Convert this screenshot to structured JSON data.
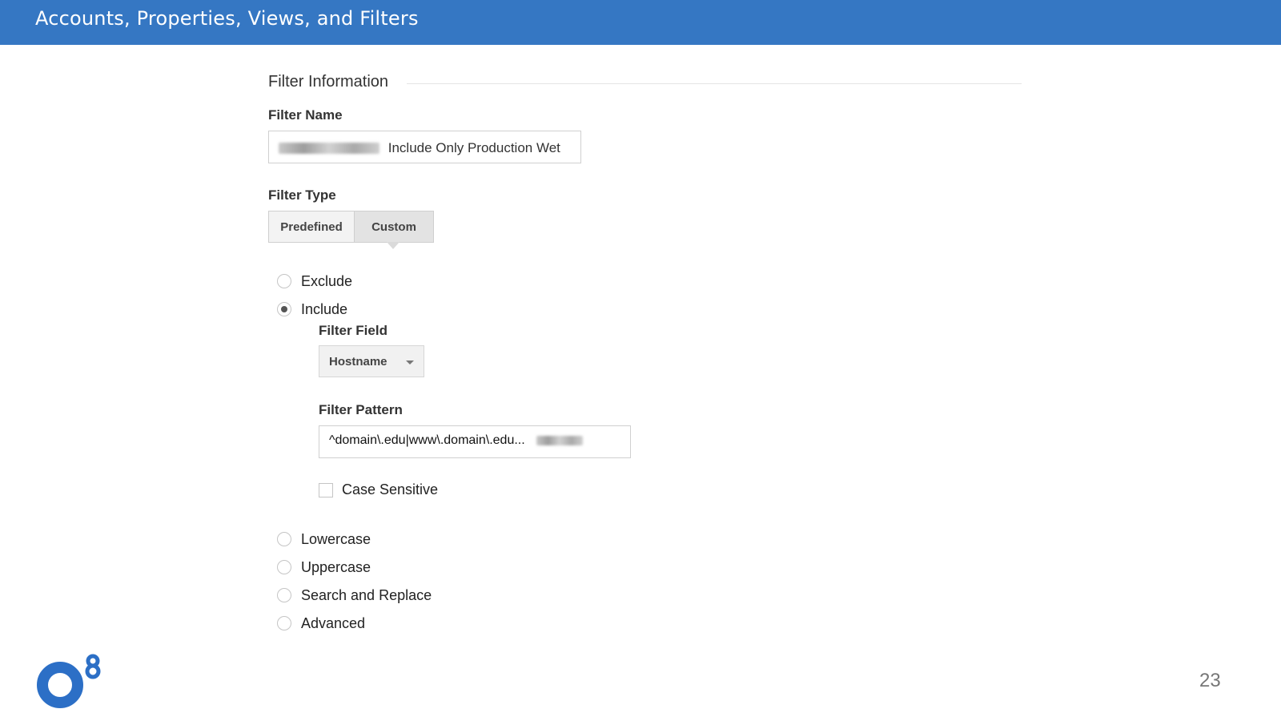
{
  "header": {
    "title": "Accounts, Properties, Views, and Filters"
  },
  "colors": {
    "header_bg": "#3577c3",
    "logo_blue": "#2c6fc6"
  },
  "section": {
    "title": "Filter Information"
  },
  "filter_name": {
    "label": "Filter Name",
    "value": "Include Only Production Wet"
  },
  "filter_type": {
    "label": "Filter Type",
    "tabs": [
      "Predefined",
      "Custom"
    ],
    "selected_tab": "Custom"
  },
  "options": {
    "exclude": "Exclude",
    "include": "Include",
    "selected": "Include",
    "lowercase": "Lowercase",
    "uppercase": "Uppercase",
    "search_replace": "Search and Replace",
    "advanced": "Advanced"
  },
  "filter_field": {
    "label": "Filter Field",
    "value": "Hostname"
  },
  "filter_pattern": {
    "label": "Filter Pattern",
    "value": "^domain\\.edu|www\\.domain\\.edu..."
  },
  "case_sensitive": {
    "label": "Case Sensitive",
    "checked": false
  },
  "footer": {
    "logo_icon": "o8-logo-icon",
    "page_number": "23"
  }
}
